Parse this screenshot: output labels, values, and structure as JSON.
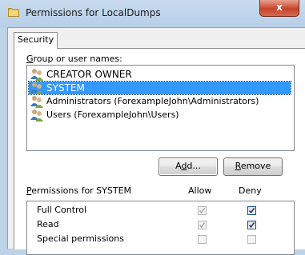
{
  "window": {
    "title": "Permissions for LocalDumps",
    "close_label": "x"
  },
  "tabs": [
    {
      "label": "Security"
    }
  ],
  "group_label_hotkey": "G",
  "group_label_rest": "roup or user names:",
  "users": [
    {
      "name": "CREATOR OWNER",
      "selected": false
    },
    {
      "name": "SYSTEM",
      "selected": true
    },
    {
      "name": "Administrators (ForexampleJohn\\Administrators)",
      "selected": false
    },
    {
      "name": "Users (ForexampleJohn\\Users)",
      "selected": false
    }
  ],
  "buttons": {
    "add_prefix": "A",
    "add_hotkey": "d",
    "add_suffix": "d...",
    "remove_hotkey": "R",
    "remove_suffix": "emove"
  },
  "permissions_label_hotkey": "P",
  "permissions_label_rest": "ermissions for SYSTEM",
  "columns": {
    "allow": "Allow",
    "deny": "Deny"
  },
  "permissions": [
    {
      "name": "Full Control",
      "allow": true,
      "allow_enabled": false,
      "deny": true,
      "deny_enabled": true
    },
    {
      "name": "Read",
      "allow": true,
      "allow_enabled": false,
      "deny": true,
      "deny_enabled": true
    },
    {
      "name": "Special permissions",
      "allow": false,
      "allow_enabled": false,
      "deny": false,
      "deny_enabled": false
    }
  ],
  "colors": {
    "selection": "#3399ff",
    "title_bar": "#c8dbee",
    "close_button": "#c7432a"
  }
}
